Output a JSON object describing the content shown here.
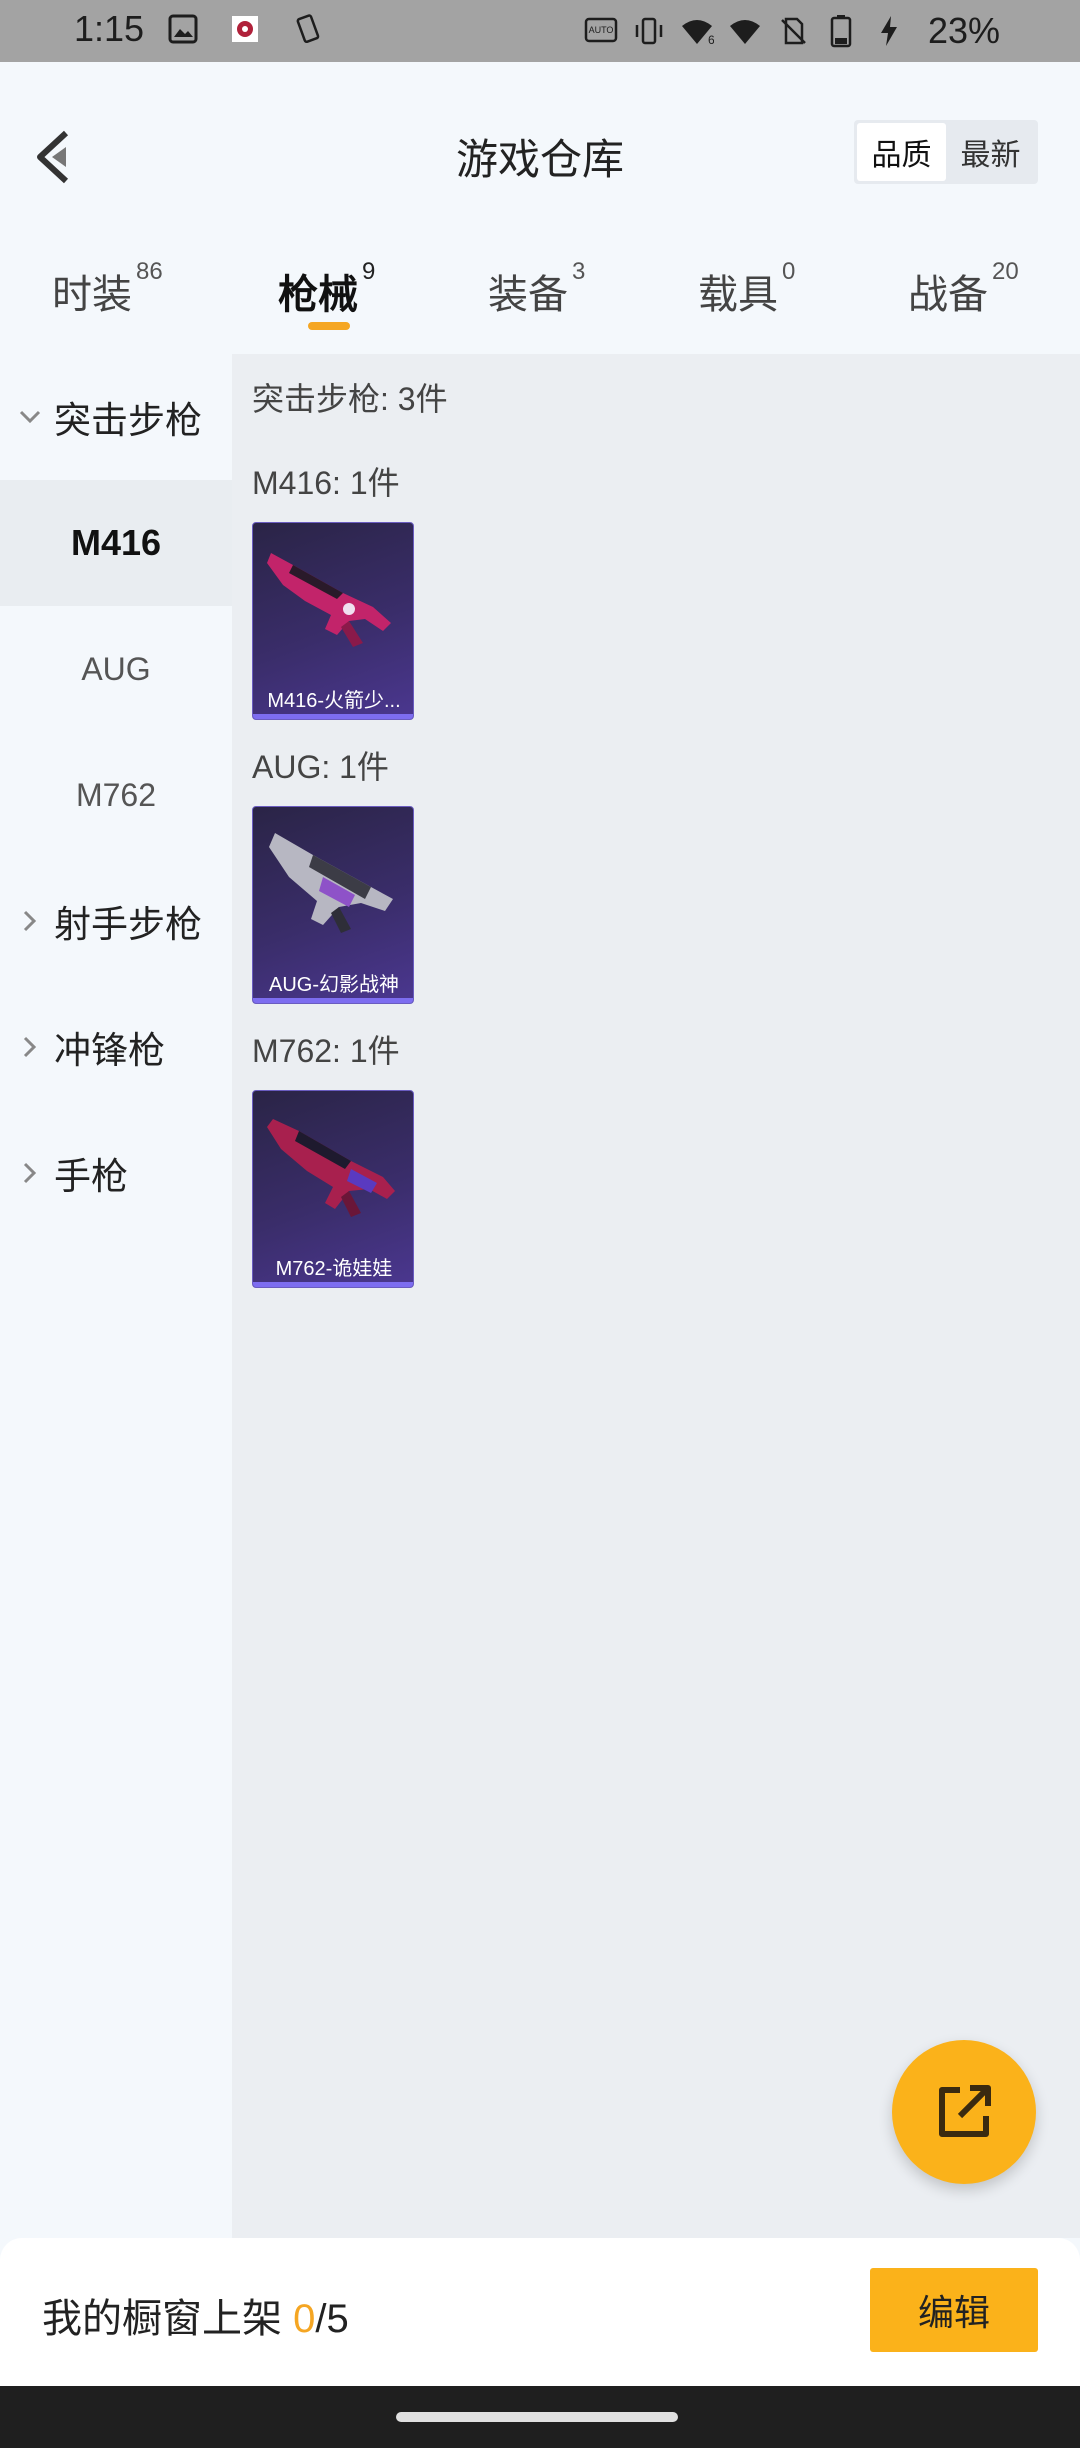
{
  "status_bar": {
    "time": "1:15",
    "battery": "23%"
  },
  "header": {
    "title": "游戏仓库",
    "sort_options": [
      "品质",
      "最新"
    ],
    "active_sort": "品质"
  },
  "tabs": [
    {
      "label": "时装",
      "count": "86"
    },
    {
      "label": "枪械",
      "count": "9",
      "active": true
    },
    {
      "label": "装备",
      "count": "3"
    },
    {
      "label": "载具",
      "count": "0"
    },
    {
      "label": "战备",
      "count": "20"
    }
  ],
  "sidebar": {
    "categories": [
      {
        "label": "突击步枪",
        "expanded": true
      },
      {
        "label": "射手步枪"
      },
      {
        "label": "冲锋枪"
      },
      {
        "label": "手枪"
      }
    ],
    "subitems": [
      "M416",
      "AUG",
      "M762"
    ],
    "active_subitem": "M416"
  },
  "main": {
    "category_heading": "突击步枪: 3件",
    "groups": [
      {
        "heading": "M416: 1件",
        "item": "M416-火箭少..."
      },
      {
        "heading": "AUG: 1件",
        "item": "AUG-幻影战神"
      },
      {
        "heading": "M762: 1件",
        "item": "M762-诡娃娃"
      }
    ]
  },
  "bottom": {
    "shelf_prefix": "我的橱窗上架 ",
    "shelf_count": "0",
    "shelf_total": "/5",
    "edit_label": "编辑"
  },
  "colors": {
    "accent": "#fbb21a",
    "card_bg": "#3a2d6a"
  }
}
